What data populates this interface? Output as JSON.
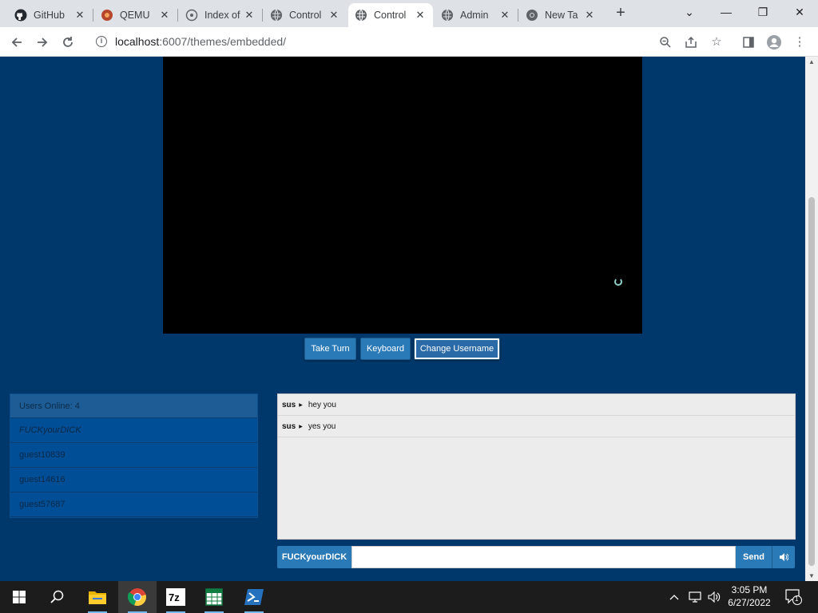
{
  "browser": {
    "tabs": [
      {
        "title": "GitHub",
        "icon": "github-icon",
        "active": false
      },
      {
        "title": "QEMU",
        "icon": "qemu-icon",
        "active": false
      },
      {
        "title": "Index of",
        "icon": "index-icon",
        "active": false
      },
      {
        "title": "Control",
        "icon": "globe-icon",
        "active": false
      },
      {
        "title": "Control",
        "icon": "globe-icon",
        "active": true
      },
      {
        "title": "Admin",
        "icon": "globe-icon",
        "active": false
      },
      {
        "title": "New Ta",
        "icon": "chrome-icon",
        "active": false
      }
    ],
    "new_tab_glyph": "+",
    "url_host": "localhost",
    "url_rest": ":6007/themes/embedded/"
  },
  "vm": {
    "buttons": {
      "take_turn": "Take Turn",
      "keyboard": "Keyboard",
      "change_username": "Change Username"
    }
  },
  "users": {
    "header": "Users Online: 4",
    "list": [
      "FUCKyourDICK",
      "guest10839",
      "guest14616",
      "guest57687"
    ]
  },
  "chat": {
    "messages": [
      {
        "user": "sus",
        "text": "hey you"
      },
      {
        "user": "sus",
        "text": "yes you"
      }
    ],
    "username_button": "FUCKyourDICK",
    "input_value": "",
    "send_label": "Send"
  },
  "taskbar": {
    "time": "3:05 PM",
    "date": "6/27/2022",
    "notification_count": "1"
  },
  "colors": {
    "page_bg": "#00386b",
    "button_bg": "#2a7ab8",
    "user_row_bg": "#004e96"
  }
}
